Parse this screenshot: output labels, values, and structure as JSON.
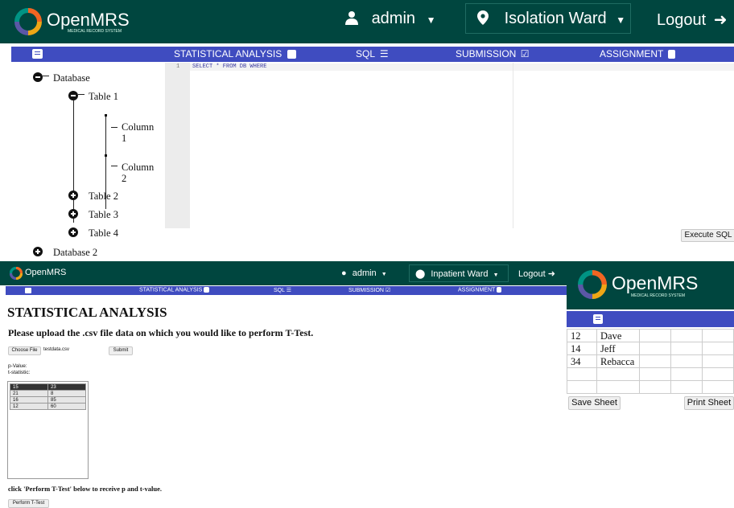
{
  "top": {
    "brand": "OpenMRS",
    "brand_sub": "MEDICAL RECORD SYSTEM",
    "user": "admin",
    "location": "Isolation Ward",
    "logout": "Logout",
    "nav": [
      "STATISTICAL ANALYSIS",
      "SQL",
      "SUBMISSION",
      "ASSIGNMENT"
    ],
    "tree": {
      "db1": "Database",
      "table1": "Table 1",
      "col1": [
        "Column",
        "1"
      ],
      "col2": [
        "Column",
        "2"
      ],
      "table2": "Table 2",
      "table3": "Table 3",
      "table4": "Table 4",
      "db2": "Database 2"
    },
    "editor": {
      "line_no": "1",
      "query": "SELECT * FROM DB WHERE"
    },
    "execute": "Execute SQL"
  },
  "bottom": {
    "brand": "OpenMRS",
    "user": "admin",
    "location": "Inpatient Ward",
    "logout": "Logout",
    "nav": [
      "STATISTICAL ANALYSIS",
      "SQL",
      "SUBMISSION",
      "ASSIGNMENT"
    ],
    "heading": "STATISTICAL ANALYSIS",
    "upload_prompt": "Please upload the .csv file data on which you would like to perform T-Test.",
    "choose_file": "Choose File",
    "file_name": "testdata.csv",
    "submit": "Submit",
    "p_value": "p-Value:",
    "t_stat": "t-statistic:",
    "table": {
      "header": [
        "15",
        "23"
      ],
      "rows": [
        [
          "21",
          "8"
        ],
        [
          "16",
          "85"
        ],
        [
          "12",
          "60"
        ]
      ]
    },
    "instruction": "click 'Perform T-Test' below to receive p and t-value.",
    "perform": "Perform T-Test"
  },
  "right": {
    "brand": "OpenMRS",
    "brand_sub": "MEDICAL RECORD SYSTEM",
    "sheet": [
      [
        "12",
        "Dave"
      ],
      [
        "14",
        "Jeff"
      ],
      [
        "34",
        "Rebacca"
      ]
    ],
    "save": "Save Sheet",
    "print": "Print Sheet"
  }
}
